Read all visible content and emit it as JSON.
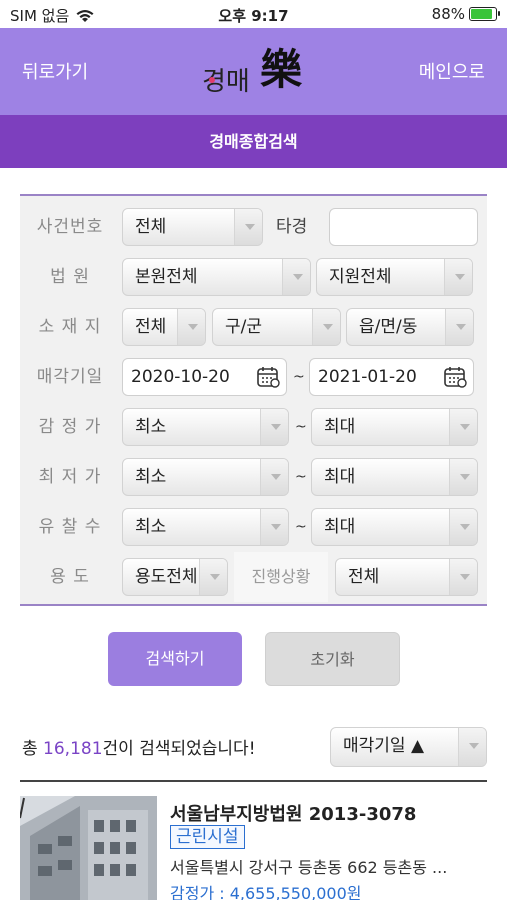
{
  "status": {
    "carrier": "SIM 없음",
    "time": "오후 9:17",
    "battery": "88%"
  },
  "header": {
    "back_label": "뒤로가기",
    "home_label": "메인으로",
    "logo_text_a": "경매",
    "logo_text_b": "樂",
    "subtitle": "경매종합검색"
  },
  "form": {
    "case_no": {
      "label": "사건번호",
      "select": "전체",
      "other_label": "타경",
      "input_value": ""
    },
    "court": {
      "label": "법 원",
      "main": "본원전체",
      "branch": "지원전체"
    },
    "location": {
      "label": "소 재 지",
      "sido": "전체",
      "gugun": "구/군",
      "dong": "읍/면/동"
    },
    "sale_date": {
      "label": "매각기일",
      "from": "2020-10-20",
      "sep": "~",
      "to": "2021-01-20"
    },
    "appraisal": {
      "label": "감 정 가",
      "min": "최소",
      "sep": "~",
      "max": "최대"
    },
    "min_price": {
      "label": "최 저 가",
      "min": "최소",
      "sep": "~",
      "max": "최대"
    },
    "fail_count": {
      "label": "유 찰 수",
      "min": "최소",
      "sep": "~",
      "max": "최대"
    },
    "usage": {
      "label": "용 도",
      "value": "용도전체",
      "status_label": "진행상황",
      "status_value": "전체"
    }
  },
  "buttons": {
    "search": "검색하기",
    "reset": "초기화"
  },
  "results": {
    "count_prefix": "총 ",
    "count": "16,181",
    "count_suffix": "건이 검색되었습니다!",
    "sort": "매각기일 ▲",
    "items": [
      {
        "title": "서울남부지방법원 2013-3078",
        "type": "근린시설",
        "address": "서울특별시 강서구 등촌동 662 등촌동 ...",
        "appraisal": "감정가 : 4,655,550,000원"
      }
    ]
  },
  "colors": {
    "header": "#9e82e4",
    "subheader": "#7d3fbe",
    "accent": "#7a44c6",
    "link": "#2b6fd0"
  }
}
